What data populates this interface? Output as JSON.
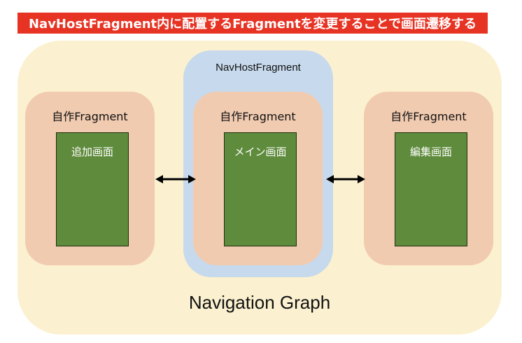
{
  "banner": {
    "text": "NavHostFragment内に配置するFragmentを変更することで画面遷移する"
  },
  "graph": {
    "label": "Navigation Graph"
  },
  "host": {
    "label": "NavHostFragment"
  },
  "fragments": [
    {
      "title": "自作Fragment",
      "screen": "追加画面"
    },
    {
      "title": "自作Fragment",
      "screen": "メイン画面"
    },
    {
      "title": "自作Fragment",
      "screen": "編集画面"
    }
  ],
  "colors": {
    "banner": "#e73323",
    "graph_background": "#fbf1d0",
    "host_background": "#c7d9ec",
    "fragment_background": "#f1cbb0",
    "screen_background": "#5f8b3c"
  }
}
